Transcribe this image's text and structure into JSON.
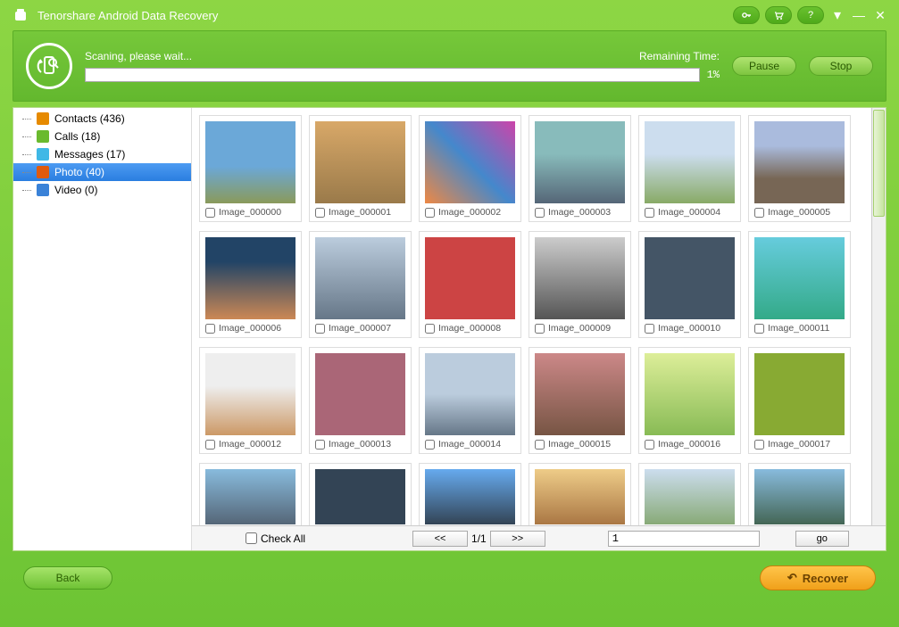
{
  "app": {
    "title": "Tenorshare Android Data Recovery"
  },
  "scan": {
    "status": "Scaning, please wait...",
    "remaining_label": "Remaining Time:",
    "percent": "1%",
    "pause": "Pause",
    "stop": "Stop"
  },
  "sidebar": {
    "items": [
      {
        "label": "Contacts (436)",
        "icon": "ic-contacts"
      },
      {
        "label": "Calls (18)",
        "icon": "ic-calls"
      },
      {
        "label": "Messages (17)",
        "icon": "ic-messages"
      },
      {
        "label": "Photo (40)",
        "icon": "ic-photo",
        "selected": true
      },
      {
        "label": "Video (0)",
        "icon": "ic-video"
      }
    ]
  },
  "thumbs": [
    {
      "name": "Image_000000"
    },
    {
      "name": "Image_000001"
    },
    {
      "name": "Image_000002"
    },
    {
      "name": "Image_000003"
    },
    {
      "name": "Image_000004"
    },
    {
      "name": "Image_000005"
    },
    {
      "name": "Image_000006"
    },
    {
      "name": "Image_000007"
    },
    {
      "name": "Image_000008"
    },
    {
      "name": "Image_000009"
    },
    {
      "name": "Image_000010"
    },
    {
      "name": "Image_000011"
    },
    {
      "name": "Image_000012"
    },
    {
      "name": "Image_000013"
    },
    {
      "name": "Image_000014"
    },
    {
      "name": "Image_000015"
    },
    {
      "name": "Image_000016"
    },
    {
      "name": "Image_000017"
    }
  ],
  "pager": {
    "check_all": "Check All",
    "prev": "<<",
    "pages": "1/1",
    "next": ">>",
    "page_input": "1",
    "go": "go"
  },
  "footer": {
    "back": "Back",
    "recover": "Recover"
  }
}
